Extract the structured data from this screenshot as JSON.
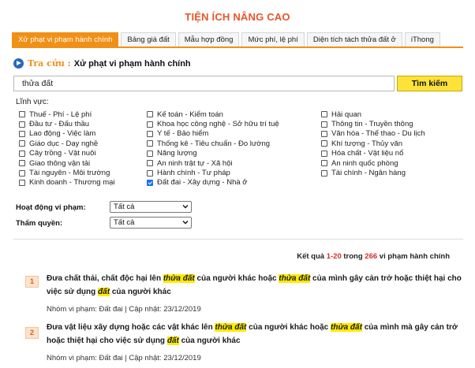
{
  "header": {
    "title": "TIỆN ÍCH NÂNG CAO"
  },
  "tabs": [
    {
      "label": "Xử phạt vi phạm hành chính",
      "active": true
    },
    {
      "label": "Bảng giá đất",
      "active": false
    },
    {
      "label": "Mẫu hợp đồng",
      "active": false
    },
    {
      "label": "Mức phí, lệ phí",
      "active": false
    },
    {
      "label": "Diện tích tách thửa đất ở",
      "active": false
    },
    {
      "label": "iThong",
      "active": false
    }
  ],
  "search": {
    "tracuu_label": "Tra cứu :",
    "title": "Xử phạt vi phạm hành chính",
    "query": "thửa đất",
    "button_label": "Tìm kiếm"
  },
  "fields": {
    "label": "Lĩnh vực:",
    "col1": [
      {
        "label": "Thuế - Phí - Lệ phí",
        "checked": false
      },
      {
        "label": "Đầu tư - Đấu thầu",
        "checked": false
      },
      {
        "label": "Lao động - Việc làm",
        "checked": false
      },
      {
        "label": "Giáo dục - Dạy nghề",
        "checked": false
      },
      {
        "label": "Cây trồng - Vật nuôi",
        "checked": false
      },
      {
        "label": "Giao thông vận tải",
        "checked": false
      },
      {
        "label": "Tài nguyên - Môi trường",
        "checked": false
      },
      {
        "label": "Kinh doanh - Thương mại",
        "checked": false
      }
    ],
    "col2": [
      {
        "label": "Kế toán - Kiểm toán",
        "checked": false
      },
      {
        "label": "Khoa học công nghệ - Sở hữu trí tuệ",
        "checked": false
      },
      {
        "label": "Y tế - Bảo hiểm",
        "checked": false
      },
      {
        "label": "Thống kê - Tiêu chuẩn - Đo lường",
        "checked": false
      },
      {
        "label": "Năng lượng",
        "checked": false
      },
      {
        "label": "An ninh trật tự - Xã hội",
        "checked": false
      },
      {
        "label": "Hành chính - Tư pháp",
        "checked": false
      },
      {
        "label": "Đất đai - Xây dựng - Nhà ở",
        "checked": true
      }
    ],
    "col3": [
      {
        "label": "Hải quan",
        "checked": false
      },
      {
        "label": "Thông tin - Truyền thông",
        "checked": false
      },
      {
        "label": "Văn hóa - Thể thao - Du lịch",
        "checked": false
      },
      {
        "label": "Khí tượng - Thủy văn",
        "checked": false
      },
      {
        "label": "Hóa chất - Vật liệu nổ",
        "checked": false
      },
      {
        "label": "An ninh quốc phòng",
        "checked": false
      },
      {
        "label": "Tài chính - Ngân hàng",
        "checked": false
      }
    ]
  },
  "filters": [
    {
      "label": "Hoạt động vi phạm:",
      "value": "Tất cả"
    },
    {
      "label": "Thẩm quyền:",
      "value": "Tất cả"
    }
  ],
  "results": {
    "prefix": "Kết quả",
    "range": "1-20",
    "mid": "trong",
    "total": "266",
    "suffix": "vi phạm hành chính",
    "items": [
      {
        "number": "1",
        "segments": [
          {
            "text": "Đưa chất thải, chất độc hại lên ",
            "hl": false
          },
          {
            "text": "thửa đất",
            "hl": true
          },
          {
            "text": " của người khác hoặc ",
            "hl": false
          },
          {
            "text": "thửa đất",
            "hl": true
          },
          {
            "text": " của mình gây cản trở hoặc thiệt hại cho việc sử dụng ",
            "hl": false
          },
          {
            "text": "đất",
            "hl": true
          },
          {
            "text": " của người khác",
            "hl": false
          }
        ],
        "meta": "Nhóm vi phạm: Đất đai  |  Cập nhật: 23/12/2019"
      },
      {
        "number": "2",
        "segments": [
          {
            "text": "Đưa vật liệu xây dựng hoặc các vật khác lên ",
            "hl": false
          },
          {
            "text": "thửa đất",
            "hl": true
          },
          {
            "text": " của người khác hoặc ",
            "hl": false
          },
          {
            "text": "thửa đất",
            "hl": true
          },
          {
            "text": " của mình mà gây cản trở hoặc thiệt hại cho việc sử dụng ",
            "hl": false
          },
          {
            "text": "đất",
            "hl": true
          },
          {
            "text": " của người khác",
            "hl": false
          }
        ],
        "meta": "Nhóm vi phạm: Đất đai  |  Cập nhật: 23/12/2019"
      }
    ]
  },
  "colors": {
    "accent": "#f19016",
    "title": "#e8552a",
    "highlight": "#ffea00",
    "search_button": "#fde23a",
    "link_red": "#d62b2b"
  },
  "icons": [
    "play-circle-icon",
    "chevron-down-icon",
    "checkbox-icon"
  ]
}
